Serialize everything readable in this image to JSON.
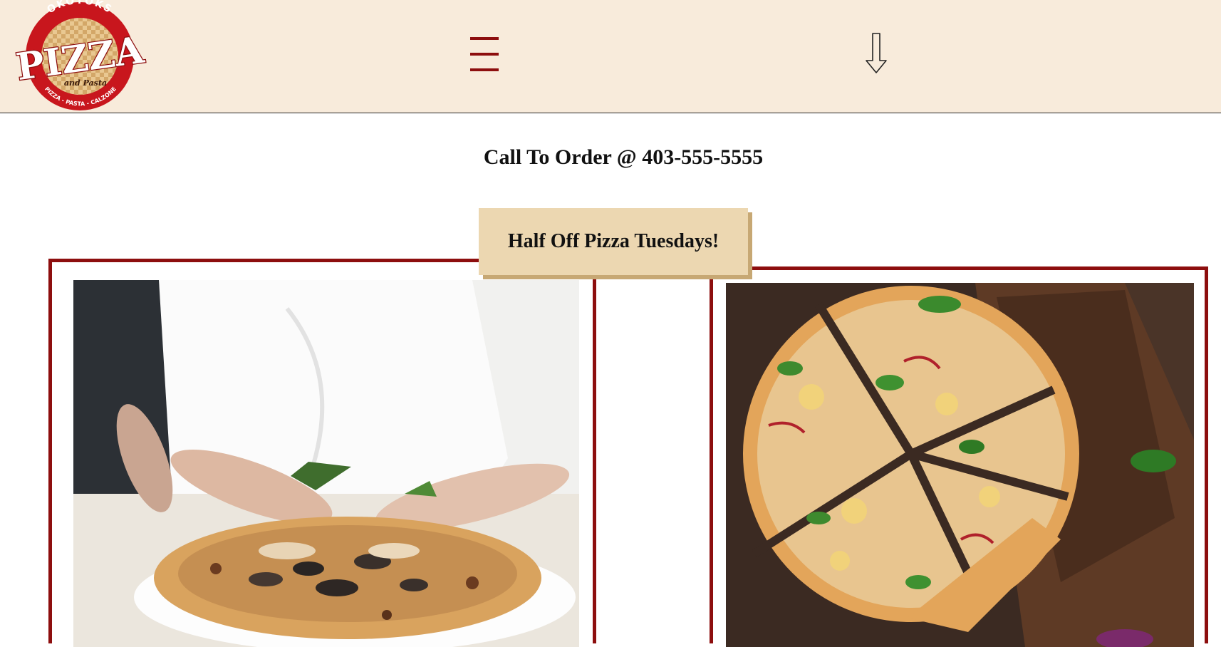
{
  "header": {
    "logo": {
      "top_arc": "OKOTOKS",
      "main": "PIZZA",
      "sub": "and Pasta",
      "bottom_arc": "PIZZA - PASTA - CALZONE"
    },
    "menu_icon": "hamburger-menu-icon",
    "scroll_icon": "down-arrow-icon"
  },
  "main": {
    "phone_line": "Call To Order @ 403-555-5555",
    "promo_label": "Half Off Pizza Tuesdays!"
  },
  "colors": {
    "header_bg": "#f8ebdb",
    "brand_red": "#8d0e0e",
    "promo_bg": "#ecd7b1",
    "promo_shadow": "#c7a874"
  },
  "gallery": [
    {
      "image": "chef-garnishing-pizza-photo"
    },
    {
      "image": "sliced-bbq-chicken-pizza-photo"
    }
  ]
}
